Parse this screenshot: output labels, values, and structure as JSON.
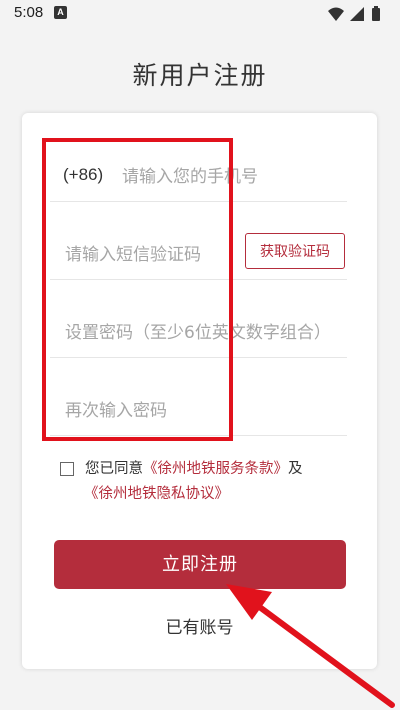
{
  "status": {
    "time": "5:08",
    "notification_letter": "A"
  },
  "page": {
    "title": "新用户注册"
  },
  "form": {
    "phone_prefix": "(+86)",
    "phone_placeholder": "请输入您的手机号",
    "sms_code_placeholder": "请输入短信验证码",
    "sms_button_label": "获取验证码",
    "password_placeholder": "设置密码（至少6位英文数字组合）",
    "confirm_password_placeholder": "再次输入密码"
  },
  "agreement": {
    "prefix_text": "您已同意",
    "service_terms": "《徐州地铁服务条款》",
    "conjunction": "及",
    "privacy_policy": "《徐州地铁隐私协议》",
    "checked": false
  },
  "actions": {
    "register_label": "立即注册",
    "login_label": "已有账号"
  },
  "colors": {
    "accent": "#b42d3c",
    "annotation_red": "#e1121c",
    "background": "#f3f3f3"
  },
  "icons": [
    "wifi-icon",
    "cellular-signal-icon",
    "battery-icon"
  ]
}
